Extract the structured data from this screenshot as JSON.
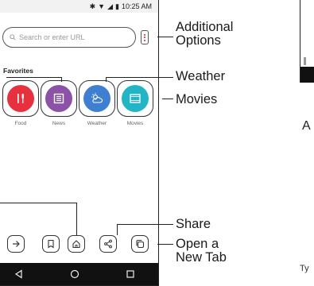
{
  "status_bar": {
    "time": "10:25 AM"
  },
  "address_bar": {
    "placeholder": "Search or enter URL"
  },
  "favorites": {
    "title": "Favorites",
    "items": [
      {
        "label": "Food",
        "color": "#e8313f",
        "icon": "food-icon"
      },
      {
        "label": "News",
        "color": "#8b52a8",
        "icon": "news-icon"
      },
      {
        "label": "Weather",
        "color": "#3f7fd1",
        "icon": "weather-icon"
      },
      {
        "label": "Movies",
        "color": "#21b5c6",
        "icon": "movies-icon"
      }
    ]
  },
  "callouts": {
    "additional_options_line1": "Additional",
    "additional_options_line2": "Options",
    "weather": "Weather",
    "movies": "Movies",
    "share": "Share",
    "open_new_tab_line1": "Open a",
    "open_new_tab_line2": "New Tab"
  },
  "edge_text": {
    "heading_fragment": "A",
    "footer_fragment": "Ty"
  }
}
